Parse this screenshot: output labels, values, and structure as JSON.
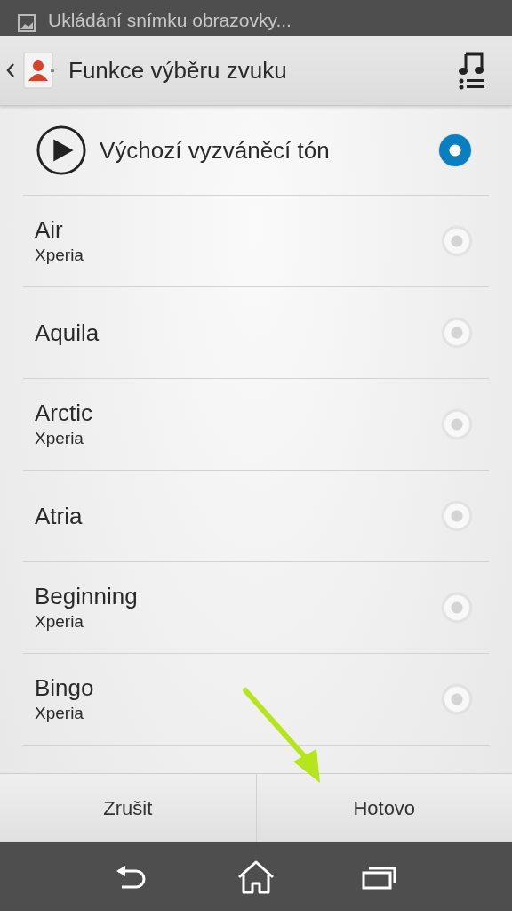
{
  "notification": {
    "text": "Ukládání snímku obrazovky..."
  },
  "action_bar": {
    "title": "Funkce výběru zvuku"
  },
  "default_item": {
    "label": "Výchozí vyzváněcí tón",
    "selected": true
  },
  "ringtones": [
    {
      "name": "Air",
      "source": "Xperia",
      "selected": false
    },
    {
      "name": "Aquila",
      "selected": false
    },
    {
      "name": "Arctic",
      "source": "Xperia",
      "selected": false
    },
    {
      "name": "Atria",
      "selected": false
    },
    {
      "name": "Beginning",
      "source": "Xperia",
      "selected": false
    },
    {
      "name": "Bingo",
      "source": "Xperia",
      "selected": false
    }
  ],
  "buttons": [
    {
      "label": "Zrušit"
    },
    {
      "label": "Hotovo"
    }
  ]
}
